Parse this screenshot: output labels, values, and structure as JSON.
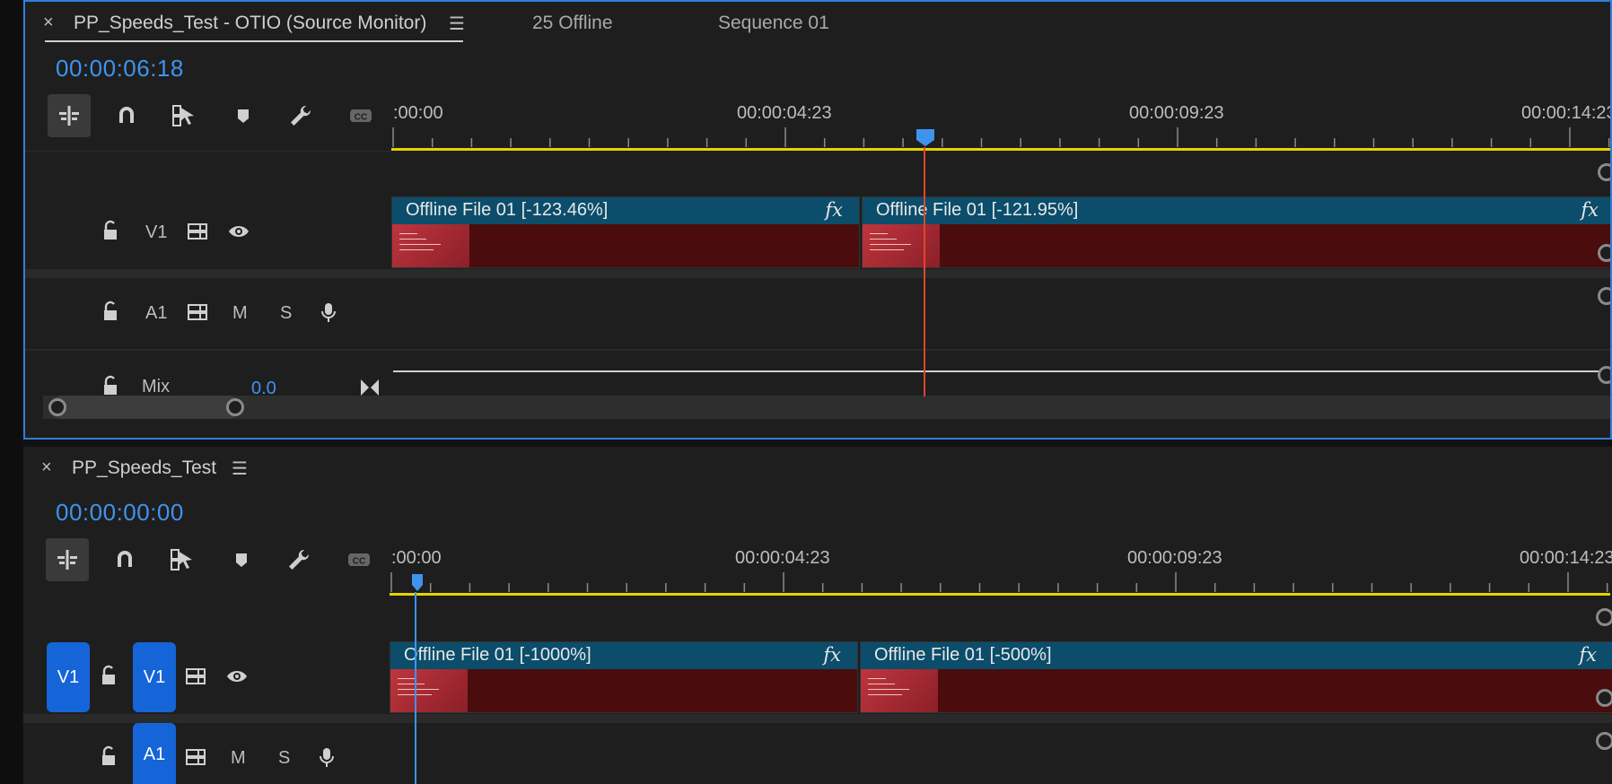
{
  "colors": {
    "accent": "#3f93ef",
    "clip_header": "#0b4d6a",
    "clip_body": "#4a0c0c",
    "work_area": "#e6d400",
    "playhead": "#e0462b",
    "target_blue": "#1565d8"
  },
  "source_monitor": {
    "tab_title": "PP_Speeds_Test - OTIO (Source Monitor)",
    "tab_offline": "25 Offline",
    "tab_sequence": "Sequence 01",
    "timecode": "00:00:06:18",
    "ruler": [
      ":00:00",
      "00:00:04:23",
      "00:00:09:23",
      "00:00:14:23"
    ],
    "tracks": {
      "v1_label": "V1",
      "a1_label": "A1",
      "mute": "M",
      "solo": "S",
      "mix_label": "Mix",
      "mix_value": "0.0"
    },
    "clips": [
      {
        "name": "Offline File 01 [-123.46%]",
        "fx": "fx"
      },
      {
        "name": "Offline File 01 [-121.95%]",
        "fx": "fx"
      }
    ]
  },
  "timeline": {
    "tab_title": "PP_Speeds_Test",
    "timecode": "00:00:00:00",
    "ruler": [
      ":00:00",
      "00:00:04:23",
      "00:00:09:23",
      "00:00:14:23"
    ],
    "tracks": {
      "v1_source": "V1",
      "v1_label": "V1",
      "a1_label": "A1",
      "mute": "M",
      "solo": "S"
    },
    "clips": [
      {
        "name": "Offline File 01 [-1000%]",
        "fx": "fx"
      },
      {
        "name": "Offline File 01 [-500%]",
        "fx": "fx"
      }
    ]
  }
}
